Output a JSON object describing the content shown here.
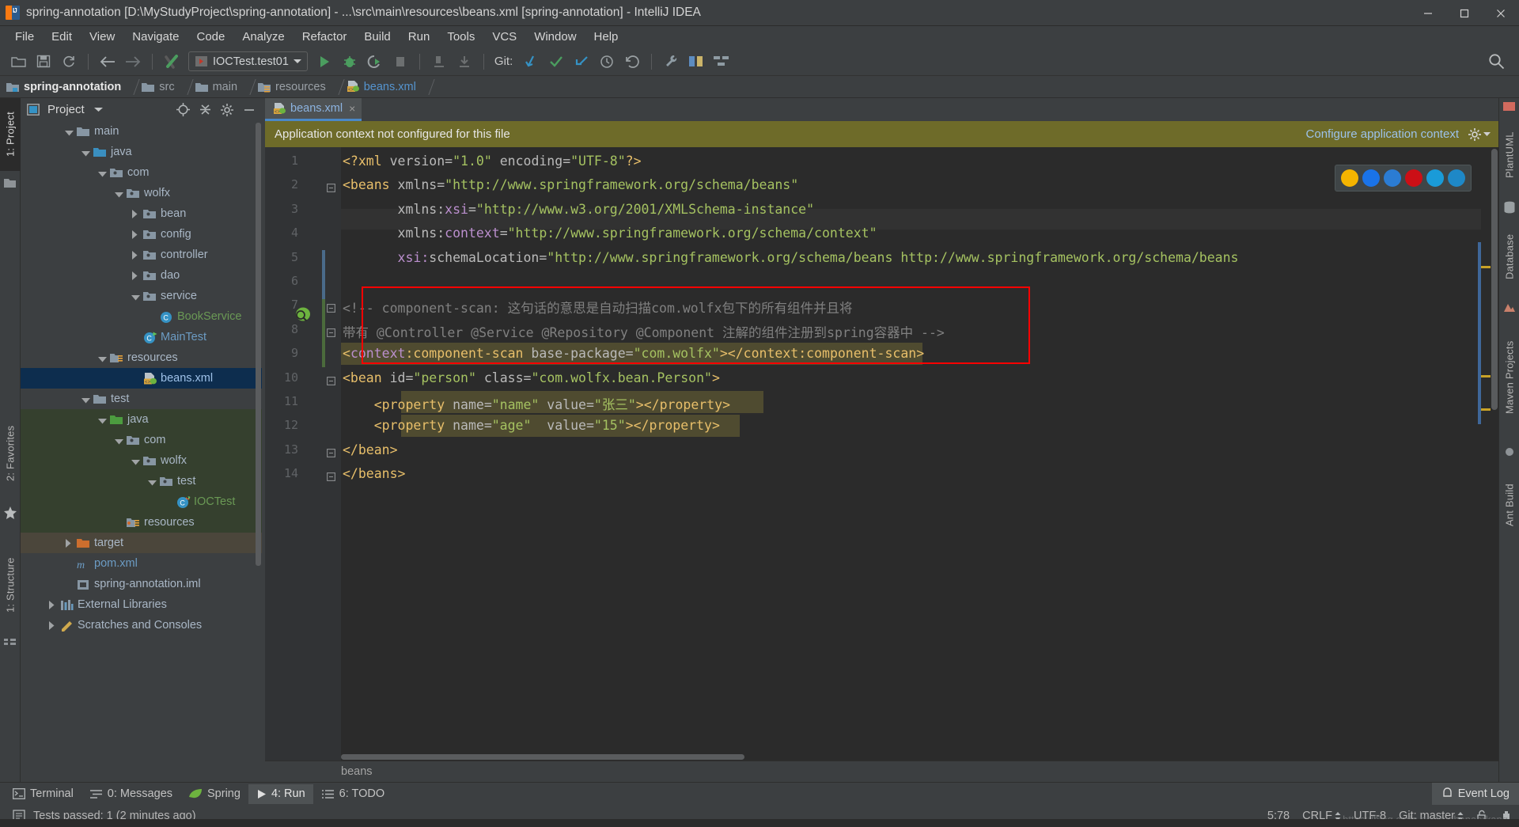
{
  "window": {
    "title": "spring-annotation [D:\\MyStudyProject\\spring-annotation] - ...\\src\\main\\resources\\beans.xml [spring-annotation] - IntelliJ IDEA",
    "minimize_label": "–",
    "maximize_label": "☐",
    "close_label": "✕"
  },
  "menu": [
    {
      "label": "File"
    },
    {
      "label": "Edit"
    },
    {
      "label": "View"
    },
    {
      "label": "Navigate"
    },
    {
      "label": "Code"
    },
    {
      "label": "Analyze"
    },
    {
      "label": "Refactor"
    },
    {
      "label": "Build"
    },
    {
      "label": "Run"
    },
    {
      "label": "Tools"
    },
    {
      "label": "VCS"
    },
    {
      "label": "Window"
    },
    {
      "label": "Help"
    }
  ],
  "toolbar": {
    "run_configuration": "IOCTest.test01",
    "git_label": "Git:",
    "icons": [
      "open-folder-icon",
      "save-all-icon",
      "sync-icon",
      "back-arrow-icon",
      "forward-arrow-icon",
      "build-icon",
      "run-icon",
      "debug-icon",
      "run-coverage-icon",
      "stop-icon",
      "profile-icon",
      "attach-icon",
      "update-project-icon",
      "commit-icon",
      "push-icon",
      "history-icon",
      "revert-icon",
      "settings-wrench-icon",
      "diff-icon",
      "structure-icon",
      "search-everywhere-icon"
    ]
  },
  "breadcrumb": [
    {
      "label": "spring-annotation",
      "style": "bold",
      "icon": "module-folder-icon"
    },
    {
      "label": "src",
      "style": "normal",
      "icon": "folder-icon"
    },
    {
      "label": "main",
      "style": "normal",
      "icon": "folder-icon"
    },
    {
      "label": "resources",
      "style": "normal",
      "icon": "resources-folder-icon"
    },
    {
      "label": "beans.xml",
      "style": "blue",
      "icon": "spring-xml-icon"
    }
  ],
  "left_tool_strip": [
    {
      "label": "1: Project",
      "selected": true
    },
    {
      "label": "2: Favorites",
      "selected": false
    },
    {
      "label": "1: Structure",
      "selected": false
    }
  ],
  "right_tool_strip": [
    {
      "label": "PlantUML"
    },
    {
      "label": "Database"
    },
    {
      "label": "Maven Projects"
    },
    {
      "label": "Ant Build"
    }
  ],
  "project_panel": {
    "title": "Project",
    "header_icons": [
      "locate-icon",
      "collapse-all-icon",
      "settings-gear-icon",
      "hide-icon"
    ],
    "tree": [
      {
        "label": "main",
        "depth": 2,
        "arrow": "down",
        "icon": "folder-icon",
        "color": "#a9b7c6",
        "row": "normal"
      },
      {
        "label": "java",
        "depth": 3,
        "arrow": "down",
        "icon": "source-folder-icon",
        "color": "#a9b7c6",
        "row": "normal"
      },
      {
        "label": "com",
        "depth": 4,
        "arrow": "down",
        "icon": "package-icon",
        "color": "#a9b7c6",
        "row": "normal"
      },
      {
        "label": "wolfx",
        "depth": 5,
        "arrow": "down",
        "icon": "package-icon",
        "color": "#a9b7c6",
        "row": "normal"
      },
      {
        "label": "bean",
        "depth": 6,
        "arrow": "right",
        "icon": "package-icon",
        "color": "#a9b7c6",
        "row": "normal"
      },
      {
        "label": "config",
        "depth": 6,
        "arrow": "right",
        "icon": "package-icon",
        "color": "#a9b7c6",
        "row": "normal"
      },
      {
        "label": "controller",
        "depth": 6,
        "arrow": "right",
        "icon": "package-icon",
        "color": "#a9b7c6",
        "row": "normal"
      },
      {
        "label": "dao",
        "depth": 6,
        "arrow": "right",
        "icon": "package-icon",
        "color": "#a9b7c6",
        "row": "normal"
      },
      {
        "label": "service",
        "depth": 6,
        "arrow": "down",
        "icon": "package-icon",
        "color": "#a9b7c6",
        "row": "normal"
      },
      {
        "label": "BookService",
        "depth": 7,
        "arrow": "none",
        "icon": "java-class-icon",
        "color": "#6a9955",
        "row": "normal"
      },
      {
        "label": "MainTest",
        "depth": 6,
        "arrow": "none",
        "icon": "java-runnable-class-icon",
        "color": "#6c9cc4",
        "row": "normal"
      },
      {
        "label": "resources",
        "depth": 4,
        "arrow": "down",
        "icon": "resources-folder-icon",
        "color": "#a9b7c6",
        "row": "normal"
      },
      {
        "label": "beans.xml",
        "depth": 6,
        "arrow": "none",
        "icon": "spring-xml-icon",
        "color": "#9ec1e8",
        "row": "selected"
      },
      {
        "label": "test",
        "depth": 3,
        "arrow": "down",
        "icon": "folder-icon",
        "color": "#a9b7c6",
        "row": "normal"
      },
      {
        "label": "java",
        "depth": 4,
        "arrow": "down",
        "icon": "test-source-folder-icon",
        "color": "#a9b7c6",
        "row": "green"
      },
      {
        "label": "com",
        "depth": 5,
        "arrow": "down",
        "icon": "package-icon",
        "color": "#a9b7c6",
        "row": "green"
      },
      {
        "label": "wolfx",
        "depth": 6,
        "arrow": "down",
        "icon": "package-icon",
        "color": "#a9b7c6",
        "row": "green"
      },
      {
        "label": "test",
        "depth": 7,
        "arrow": "down",
        "icon": "package-icon",
        "color": "#a9b7c6",
        "row": "green"
      },
      {
        "label": "IOCTest",
        "depth": 8,
        "arrow": "none",
        "icon": "java-test-class-icon",
        "color": "#6a9955",
        "row": "green"
      },
      {
        "label": "resources",
        "depth": 5,
        "arrow": "none",
        "icon": "test-resources-folder-icon",
        "color": "#a9b7c6",
        "row": "green"
      },
      {
        "label": "target",
        "depth": 2,
        "arrow": "right",
        "icon": "excluded-folder-icon",
        "color": "#a9b7c6",
        "row": "brown"
      },
      {
        "label": "pom.xml",
        "depth": 2,
        "arrow": "none",
        "icon": "maven-pom-icon",
        "color": "#6c9cc4",
        "row": "normal"
      },
      {
        "label": "spring-annotation.iml",
        "depth": 2,
        "arrow": "none",
        "icon": "iml-module-icon",
        "color": "#a9b7c6",
        "row": "normal"
      },
      {
        "label": "External Libraries",
        "depth": 1,
        "arrow": "right",
        "icon": "libraries-icon",
        "color": "#a9b7c6",
        "row": "normal"
      },
      {
        "label": "Scratches and Consoles",
        "depth": 1,
        "arrow": "right",
        "icon": "scratches-icon",
        "color": "#a9b7c6",
        "row": "normal"
      }
    ]
  },
  "editor": {
    "tab": {
      "label": "beans.xml",
      "icon": "spring-xml-icon",
      "close_label": "×"
    },
    "notification": {
      "message": "Application context not configured for this file",
      "action_label": "Configure application context",
      "gear_icon": "gear-icon",
      "chevron_icon": "chevron-down-icon"
    },
    "browser_launchers": [
      "chrome-icon",
      "firefox-icon",
      "safari-icon",
      "opera-icon",
      "ie-icon",
      "edge-icon"
    ],
    "line_numbers": [
      "1",
      "2",
      "3",
      "4",
      "5",
      "6",
      "7",
      "8",
      "9",
      "10",
      "11",
      "12",
      "13",
      "14"
    ],
    "lines": [
      {
        "n": 1,
        "segments": [
          {
            "t": "<?xml ",
            "c": "t-pi"
          },
          {
            "t": "version",
            "c": "t-attr"
          },
          {
            "t": "=",
            "c": "t-eq"
          },
          {
            "t": "\"1.0\"",
            "c": "t-val"
          },
          {
            "t": " ",
            "c": "t-attr"
          },
          {
            "t": "encoding",
            "c": "t-attr"
          },
          {
            "t": "=",
            "c": "t-eq"
          },
          {
            "t": "\"UTF-8\"",
            "c": "t-val"
          },
          {
            "t": "?>",
            "c": "t-pi"
          }
        ]
      },
      {
        "n": 2,
        "segments": [
          {
            "t": "<beans",
            "c": "t-tag"
          },
          {
            "t": " xmlns",
            "c": "t-attr"
          },
          {
            "t": "=",
            "c": "t-eq"
          },
          {
            "t": "\"http://www.springframework.org/schema/beans\"",
            "c": "t-val"
          }
        ]
      },
      {
        "n": 3,
        "segments": [
          {
            "t": "       xmlns:",
            "c": "t-attr"
          },
          {
            "t": "xsi",
            "c": "t-ns"
          },
          {
            "t": "=",
            "c": "t-eq"
          },
          {
            "t": "\"http://www.w3.org/2001/XMLSchema-instance\"",
            "c": "t-val"
          }
        ]
      },
      {
        "n": 4,
        "segments": [
          {
            "t": "       xmlns:",
            "c": "t-attr"
          },
          {
            "t": "context",
            "c": "t-ns"
          },
          {
            "t": "=",
            "c": "t-eq"
          },
          {
            "t": "\"http://www.springframework.org/schema/context\"",
            "c": "t-val"
          }
        ]
      },
      {
        "n": 5,
        "segments": [
          {
            "t": "       xsi:",
            "c": "t-ns"
          },
          {
            "t": "schemaLocation",
            "c": "t-attr"
          },
          {
            "t": "=",
            "c": "t-eq"
          },
          {
            "t": "\"http://www.springframework.org/schema/beans http://www.springframework.org/schema/beans",
            "c": "t-val"
          }
        ]
      },
      {
        "n": 6,
        "segments": []
      },
      {
        "n": 7,
        "segments": [
          {
            "t": "<!-- component-scan: 这句话的意思是自动扫描com.wolfx包下的所有组件并且将",
            "c": "t-cmt"
          }
        ]
      },
      {
        "n": 8,
        "segments": [
          {
            "t": "带有 @Controller @Service @Repository @Component 注解的组件注册到spring容器中 -->",
            "c": "t-cmt"
          }
        ]
      },
      {
        "n": 9,
        "segments": [
          {
            "t": "<",
            "c": "t-tag"
          },
          {
            "t": "context",
            "c": "t-ns"
          },
          {
            "t": ":",
            "c": "t-tag"
          },
          {
            "t": "component-scan",
            "c": "t-tag"
          },
          {
            "t": " base-package",
            "c": "t-attr"
          },
          {
            "t": "=",
            "c": "t-eq"
          },
          {
            "t": "\"com.wolfx\"",
            "c": "t-val"
          },
          {
            "t": "></",
            "c": "t-tag"
          },
          {
            "t": "context:component-scan",
            "c": "t-tag"
          },
          {
            "t": ">",
            "c": "t-tag"
          }
        ]
      },
      {
        "n": 10,
        "segments": [
          {
            "t": "<bean",
            "c": "t-tag"
          },
          {
            "t": " id",
            "c": "t-attr"
          },
          {
            "t": "=",
            "c": "t-eq"
          },
          {
            "t": "\"person\"",
            "c": "t-val"
          },
          {
            "t": " class",
            "c": "t-attr"
          },
          {
            "t": "=",
            "c": "t-eq"
          },
          {
            "t": "\"com.wolfx.bean.Person\"",
            "c": "t-val"
          },
          {
            "t": ">",
            "c": "t-tag"
          }
        ]
      },
      {
        "n": 11,
        "segments": [
          {
            "t": "    <property",
            "c": "t-tag"
          },
          {
            "t": " name",
            "c": "t-attr"
          },
          {
            "t": "=",
            "c": "t-eq"
          },
          {
            "t": "\"name\"",
            "c": "t-val"
          },
          {
            "t": " value",
            "c": "t-attr"
          },
          {
            "t": "=",
            "c": "t-eq"
          },
          {
            "t": "\"张三\"",
            "c": "t-val"
          },
          {
            "t": "></",
            "c": "t-tag"
          },
          {
            "t": "property",
            "c": "t-tag"
          },
          {
            "t": ">",
            "c": "t-tag"
          }
        ]
      },
      {
        "n": 12,
        "segments": [
          {
            "t": "    <property",
            "c": "t-tag"
          },
          {
            "t": " name",
            "c": "t-attr"
          },
          {
            "t": "=",
            "c": "t-eq"
          },
          {
            "t": "\"age\"",
            "c": "t-val"
          },
          {
            "t": "  value",
            "c": "t-attr"
          },
          {
            "t": "=",
            "c": "t-eq"
          },
          {
            "t": "\"15\"",
            "c": "t-val"
          },
          {
            "t": "></",
            "c": "t-tag"
          },
          {
            "t": "property",
            "c": "t-tag"
          },
          {
            "t": ">",
            "c": "t-tag"
          }
        ]
      },
      {
        "n": 13,
        "segments": [
          {
            "t": "</bean>",
            "c": "t-tag"
          }
        ]
      },
      {
        "n": 14,
        "segments": [
          {
            "t": "</beans>",
            "c": "t-tag"
          }
        ]
      }
    ],
    "bottom_breadcrumb": "beans",
    "annotation_box_color": "#ff0000"
  },
  "bottom_tabs": [
    {
      "label": "Terminal",
      "icon": "terminal-icon",
      "selected": false
    },
    {
      "label": "0: Messages",
      "icon": "messages-icon",
      "selected": false
    },
    {
      "label": "Spring",
      "icon": "spring-leaf-icon",
      "selected": false
    },
    {
      "label": "4: Run",
      "icon": "run-icon",
      "selected": true
    },
    {
      "label": "6: TODO",
      "icon": "todo-icon",
      "selected": false
    }
  ],
  "event_log": {
    "label": "Event Log",
    "icon": "bell-icon"
  },
  "status_bar": {
    "message": "Tests passed: 1 (2 minutes ago)",
    "message_icon": "info-icon",
    "caret_position": "5:78",
    "line_separator": "CRLF",
    "encoding": "UTF-8",
    "branch": "Git: master",
    "lock_icon": "unlocked-icon",
    "memory_icon": "hector-icon"
  },
  "watermark": "https://blog.csdn.net/suchanaerkang",
  "colors": {
    "accent_blue": "#4a88c7",
    "notification_bg": "#6e6b29",
    "editor_bg": "#2b2b2b",
    "panel_bg": "#3c3f41",
    "selection_blue": "#0d2d4e",
    "test_green": "#35402e",
    "excluded_brown": "#4b463b",
    "annotation_red": "#ff0000",
    "highlight_olive": "#4f4b30"
  }
}
